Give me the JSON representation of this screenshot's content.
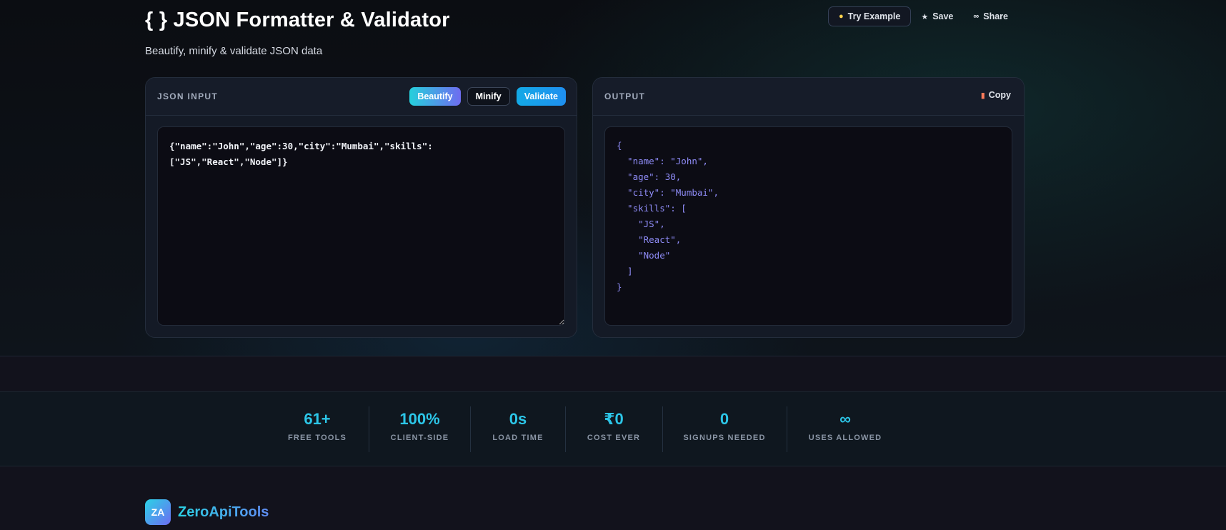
{
  "header": {
    "title": "{ } JSON Formatter & Validator",
    "subtitle": "Beautify, minify & validate JSON data",
    "actions": {
      "try_example": "Try Example",
      "save": "Save",
      "share": "Share"
    }
  },
  "input_panel": {
    "label": "JSON INPUT",
    "buttons": {
      "beautify": "Beautify",
      "minify": "Minify",
      "validate": "Validate"
    },
    "value": "{\"name\":\"John\",\"age\":30,\"city\":\"Mumbai\",\"skills\":\n[\"JS\",\"React\",\"Node\"]}"
  },
  "output_panel": {
    "label": "OUTPUT",
    "copy_label": "Copy",
    "value": "{\n  \"name\": \"John\",\n  \"age\": 30,\n  \"city\": \"Mumbai\",\n  \"skills\": [\n    \"JS\",\n    \"React\",\n    \"Node\"\n  ]\n}"
  },
  "stats": [
    {
      "value": "61+",
      "label": "FREE TOOLS"
    },
    {
      "value": "100%",
      "label": "CLIENT-SIDE"
    },
    {
      "value": "0s",
      "label": "LOAD TIME"
    },
    {
      "value": "₹0",
      "label": "COST EVER"
    },
    {
      "value": "0",
      "label": "SIGNUPS NEEDED"
    },
    {
      "value": "∞",
      "label": "USES ALLOWED"
    }
  ],
  "brand": {
    "logo_text": "ZA",
    "name": "ZeroApiTools"
  },
  "icons": {
    "try_example": "lightbulb-icon",
    "save": "star-icon",
    "share": "link-icon",
    "copy": "clipboard-icon"
  },
  "colors": {
    "accent_cyan": "#2cc6e8",
    "accent_violet": "#6f6cf0",
    "output_text": "#8f8cf7",
    "background": "#12121c"
  }
}
